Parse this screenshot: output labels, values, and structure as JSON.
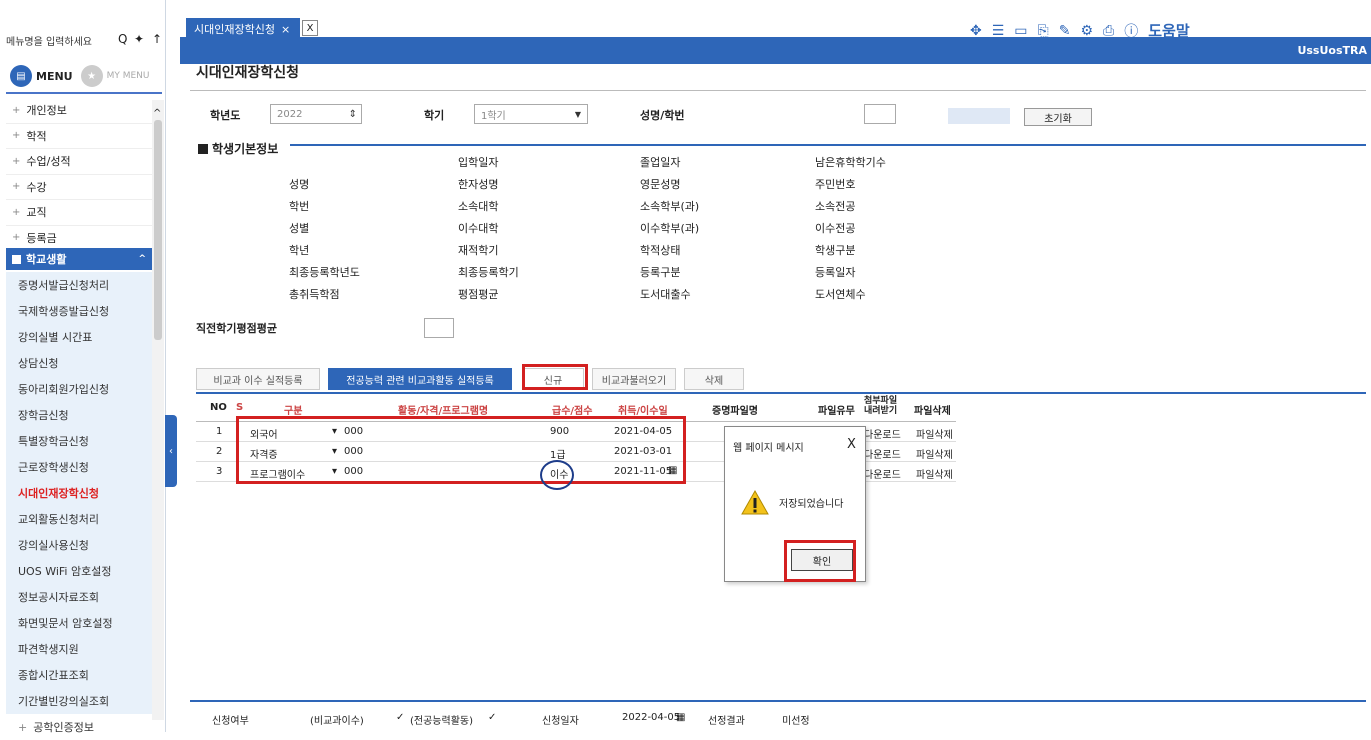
{
  "sidebar": {
    "search_placeholder": "메뉴명을 입력하세요",
    "menu_label": "MENU",
    "mymenu_label": "MY MENU",
    "items": [
      "개인정보",
      "학적",
      "수업/성적",
      "수강",
      "교직",
      "등록금"
    ],
    "category": "학교생활",
    "sub_items": [
      "증명서발급신청처리",
      "국제학생증발급신청",
      "강의실별 시간표",
      "상담신청",
      "동아리회원가입신청",
      "장학금신청",
      "특별장학금신청",
      "근로장학생신청",
      "시대인재장학신청",
      "교외활동신청처리",
      "강의실사용신청",
      "UOS WiFi 암호설정",
      "정보공시자료조회",
      "화면및문서 암호설정",
      "파견학생지원",
      "종합시간표조회",
      "기간별빈강의실조회",
      "공학인증정보"
    ],
    "active_sub": "시대인재장학신청"
  },
  "topbar": {
    "tab_label": "시대인재장학신청",
    "tab_close": "×",
    "tab_x": "X",
    "help_label": "도움말",
    "user_code": "UssUosTRA"
  },
  "page": {
    "title": "시대인재장학신청"
  },
  "filter": {
    "year_label": "학년도",
    "year_value": "2022",
    "term_label": "학기",
    "term_value": "1학기",
    "name_label": "성명/학번",
    "reset_label": "초기화"
  },
  "basic_info": {
    "heading": "학생기본정보",
    "labels": [
      [
        "성명",
        "입학일자",
        "졸업일자",
        "남은휴학학기수"
      ],
      [
        "학번",
        "한자성명",
        "영문성명",
        "주민번호"
      ],
      [
        "성별",
        "소속대학",
        "소속학부(과)",
        "소속전공"
      ],
      [
        "학년",
        "이수대학",
        "이수학부(과)",
        "이수전공"
      ],
      [
        "최종등록학년도",
        "재적학기",
        "학적상태",
        "학생구분"
      ],
      [
        "총취득학점",
        "최종등록학기",
        "등록구분",
        "등록일자"
      ],
      [
        "",
        "평점평균",
        "도서대출수",
        "도서연체수"
      ]
    ],
    "gpa_label": "직전학기평점평균"
  },
  "tabs": {
    "t1": "비교과 이수 실적등록",
    "t2": "전공능력 관련 비교과활동 실적등록",
    "new": "신규",
    "load": "비교과불러오기",
    "del": "삭제"
  },
  "grid": {
    "headers": {
      "no": "NO",
      "flag": "S",
      "kind": "구분",
      "activity": "활동/자격/프로그램명",
      "grade": "급수/점수",
      "date": "취득/이수일",
      "cert": "증명파일명",
      "exists": "파일유무",
      "download": "첨부파일 내려받기",
      "delete": "파일삭제"
    },
    "rows": [
      {
        "no": "1",
        "kind": "외국어",
        "activity": "000",
        "grade": "900",
        "date": "2021-04-05",
        "download": "다운로드",
        "delete": "파일삭제"
      },
      {
        "no": "2",
        "kind": "자격증",
        "activity": "000",
        "grade": "1급",
        "date": "2021-03-01",
        "download": "다운로드",
        "delete": "파일삭제"
      },
      {
        "no": "3",
        "kind": "프로그램이수",
        "activity": "000",
        "grade": "이수",
        "date": "2021-11-05",
        "download": "다운로드",
        "delete": "파일삭제"
      }
    ]
  },
  "dialog": {
    "title": "웹 페이지 메시지",
    "close": "X",
    "message": "저장되었습니다",
    "ok": "확인"
  },
  "footer": {
    "apply_label": "신청여부",
    "noncurricular": "(비교과이수)",
    "major_activity": "(전공능력활동)",
    "check": "✓",
    "apply_date_label": "신청일자",
    "apply_date": "2022-04-05",
    "result_label": "선정결과",
    "result_value": "미선정"
  }
}
